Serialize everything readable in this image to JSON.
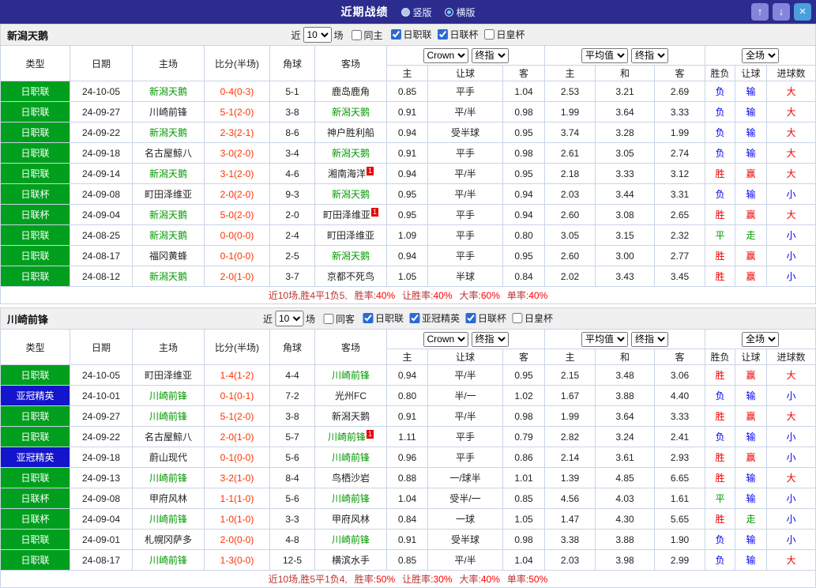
{
  "titlebar": {
    "title": "近期战绩",
    "vertical_label": "竖版",
    "horizontal_label": "横版",
    "selected_layout": "横版",
    "up_icon": "↑",
    "down_icon": "↓",
    "close_icon": "×"
  },
  "columns": {
    "type": "类型",
    "date": "日期",
    "home": "主场",
    "score": "比分(半场)",
    "corner": "角球",
    "away": "客场",
    "odds_source": "Crown",
    "odds_close": "终指",
    "avg_label": "平均值",
    "avg_close": "终指",
    "scope": "全场",
    "sub": [
      "主",
      "让球",
      "客",
      "主",
      "和",
      "客",
      "胜负",
      "让球",
      "进球数"
    ]
  },
  "colors": {
    "titlebar_bg": "#2c2c8e",
    "league_green": "#00a01e",
    "league_blue": "#1414cc",
    "focus_team_green": "#009900",
    "score_red": "#ff3300",
    "win_red": "#ee0000",
    "lose_blue": "#0000ee",
    "draw_green": "#009900"
  },
  "sections": [
    {
      "team": "新潟天鹅",
      "filter": {
        "near_label": "近",
        "count": "10",
        "games_label": "场",
        "same_label": "同主",
        "same_checked": false,
        "comps": [
          {
            "label": "日职联",
            "checked": true
          },
          {
            "label": "日联杯",
            "checked": true
          },
          {
            "label": "日皇杯",
            "checked": false
          }
        ]
      },
      "rows": [
        {
          "league": "日职联",
          "league_color": "green",
          "date": "24-10-05",
          "home": "新潟天鹅",
          "home_focus": true,
          "home_card": "",
          "score": "0-4(0-3)",
          "corner": "5-1",
          "away": "鹿岛鹿角",
          "away_focus": false,
          "away_card": "",
          "odds": [
            "0.85",
            "平手",
            "1.04"
          ],
          "avg": [
            "2.53",
            "3.21",
            "2.69"
          ],
          "results": [
            {
              "t": "负",
              "c": "blue"
            },
            {
              "t": "输",
              "c": "blue"
            },
            {
              "t": "大",
              "c": "red"
            }
          ]
        },
        {
          "league": "日职联",
          "league_color": "green",
          "date": "24-09-27",
          "home": "川崎前锋",
          "home_focus": false,
          "home_card": "",
          "score": "5-1(2-0)",
          "corner": "3-8",
          "away": "新潟天鹅",
          "away_focus": true,
          "away_card": "",
          "odds": [
            "0.91",
            "平/半",
            "0.98"
          ],
          "avg": [
            "1.99",
            "3.64",
            "3.33"
          ],
          "results": [
            {
              "t": "负",
              "c": "blue"
            },
            {
              "t": "输",
              "c": "blue"
            },
            {
              "t": "大",
              "c": "red"
            }
          ]
        },
        {
          "league": "日职联",
          "league_color": "green",
          "date": "24-09-22",
          "home": "新潟天鹅",
          "home_focus": true,
          "home_card": "",
          "score": "2-3(2-1)",
          "corner": "8-6",
          "away": "神户胜利船",
          "away_focus": false,
          "away_card": "",
          "odds": [
            "0.94",
            "受半球",
            "0.95"
          ],
          "avg": [
            "3.74",
            "3.28",
            "1.99"
          ],
          "results": [
            {
              "t": "负",
              "c": "blue"
            },
            {
              "t": "输",
              "c": "blue"
            },
            {
              "t": "大",
              "c": "red"
            }
          ]
        },
        {
          "league": "日职联",
          "league_color": "green",
          "date": "24-09-18",
          "home": "名古屋鲸八",
          "home_focus": false,
          "home_card": "",
          "score": "3-0(2-0)",
          "corner": "3-4",
          "away": "新潟天鹅",
          "away_focus": true,
          "away_card": "",
          "odds": [
            "0.91",
            "平手",
            "0.98"
          ],
          "avg": [
            "2.61",
            "3.05",
            "2.74"
          ],
          "results": [
            {
              "t": "负",
              "c": "blue"
            },
            {
              "t": "输",
              "c": "blue"
            },
            {
              "t": "大",
              "c": "red"
            }
          ]
        },
        {
          "league": "日职联",
          "league_color": "green",
          "date": "24-09-14",
          "home": "新潟天鹅",
          "home_focus": true,
          "home_card": "",
          "score": "3-1(2-0)",
          "corner": "4-6",
          "away": "湘南海洋",
          "away_focus": false,
          "away_card": "1",
          "odds": [
            "0.94",
            "平/半",
            "0.95"
          ],
          "avg": [
            "2.18",
            "3.33",
            "3.12"
          ],
          "results": [
            {
              "t": "胜",
              "c": "red"
            },
            {
              "t": "赢",
              "c": "red"
            },
            {
              "t": "大",
              "c": "red"
            }
          ]
        },
        {
          "league": "日联杯",
          "league_color": "green",
          "date": "24-09-08",
          "home": "町田泽维亚",
          "home_focus": false,
          "home_card": "",
          "score": "2-0(2-0)",
          "corner": "9-3",
          "away": "新潟天鹅",
          "away_focus": true,
          "away_card": "",
          "odds": [
            "0.95",
            "平/半",
            "0.94"
          ],
          "avg": [
            "2.03",
            "3.44",
            "3.31"
          ],
          "results": [
            {
              "t": "负",
              "c": "blue"
            },
            {
              "t": "输",
              "c": "blue"
            },
            {
              "t": "小",
              "c": "blue"
            }
          ]
        },
        {
          "league": "日联杯",
          "league_color": "green",
          "date": "24-09-04",
          "home": "新潟天鹅",
          "home_focus": true,
          "home_card": "",
          "score": "5-0(2-0)",
          "corner": "2-0",
          "away": "町田泽维亚",
          "away_focus": false,
          "away_card": "1",
          "odds": [
            "0.95",
            "平手",
            "0.94"
          ],
          "avg": [
            "2.60",
            "3.08",
            "2.65"
          ],
          "results": [
            {
              "t": "胜",
              "c": "red"
            },
            {
              "t": "赢",
              "c": "red"
            },
            {
              "t": "大",
              "c": "red"
            }
          ]
        },
        {
          "league": "日职联",
          "league_color": "green",
          "date": "24-08-25",
          "home": "新潟天鹅",
          "home_focus": true,
          "home_card": "",
          "score": "0-0(0-0)",
          "corner": "2-4",
          "away": "町田泽维亚",
          "away_focus": false,
          "away_card": "",
          "odds": [
            "1.09",
            "平手",
            "0.80"
          ],
          "avg": [
            "3.05",
            "3.15",
            "2.32"
          ],
          "results": [
            {
              "t": "平",
              "c": "green"
            },
            {
              "t": "走",
              "c": "green"
            },
            {
              "t": "小",
              "c": "blue"
            }
          ]
        },
        {
          "league": "日职联",
          "league_color": "green",
          "date": "24-08-17",
          "home": "福冈黄蜂",
          "home_focus": false,
          "home_card": "",
          "score": "0-1(0-0)",
          "corner": "2-5",
          "away": "新潟天鹅",
          "away_focus": true,
          "away_card": "",
          "odds": [
            "0.94",
            "平手",
            "0.95"
          ],
          "avg": [
            "2.60",
            "3.00",
            "2.77"
          ],
          "results": [
            {
              "t": "胜",
              "c": "red"
            },
            {
              "t": "赢",
              "c": "red"
            },
            {
              "t": "小",
              "c": "blue"
            }
          ]
        },
        {
          "league": "日职联",
          "league_color": "green",
          "date": "24-08-12",
          "home": "新潟天鹅",
          "home_focus": true,
          "home_card": "",
          "score": "2-0(1-0)",
          "corner": "3-7",
          "away": "京都不死鸟",
          "away_focus": false,
          "away_card": "",
          "odds": [
            "1.05",
            "半球",
            "0.84"
          ],
          "avg": [
            "2.02",
            "3.43",
            "3.45"
          ],
          "results": [
            {
              "t": "胜",
              "c": "red"
            },
            {
              "t": "赢",
              "c": "red"
            },
            {
              "t": "小",
              "c": "blue"
            }
          ]
        }
      ],
      "summary": {
        "prefix": "近10场,胜4平1负5,",
        "stats": [
          {
            "label": "胜率:",
            "value": "40%"
          },
          {
            "label": "让胜率:",
            "value": "40%"
          },
          {
            "label": "大率:",
            "value": "60%"
          },
          {
            "label": "单率:",
            "value": "40%"
          }
        ]
      }
    },
    {
      "team": "川崎前锋",
      "filter": {
        "near_label": "近",
        "count": "10",
        "games_label": "场",
        "same_label": "同客",
        "same_checked": false,
        "comps": [
          {
            "label": "日职联",
            "checked": true
          },
          {
            "label": "亚冠精英",
            "checked": true
          },
          {
            "label": "日联杯",
            "checked": true
          },
          {
            "label": "日皇杯",
            "checked": false
          }
        ]
      },
      "rows": [
        {
          "league": "日职联",
          "league_color": "green",
          "date": "24-10-05",
          "home": "町田泽维亚",
          "home_focus": false,
          "home_card": "",
          "score": "1-4(1-2)",
          "corner": "4-4",
          "away": "川崎前锋",
          "away_focus": true,
          "away_card": "",
          "odds": [
            "0.94",
            "平/半",
            "0.95"
          ],
          "avg": [
            "2.15",
            "3.48",
            "3.06"
          ],
          "results": [
            {
              "t": "胜",
              "c": "red"
            },
            {
              "t": "赢",
              "c": "red"
            },
            {
              "t": "大",
              "c": "red"
            }
          ]
        },
        {
          "league": "亚冠精英",
          "league_color": "blue",
          "date": "24-10-01",
          "home": "川崎前锋",
          "home_focus": true,
          "home_card": "",
          "score": "0-1(0-1)",
          "corner": "7-2",
          "away": "光州FC",
          "away_focus": false,
          "away_card": "",
          "odds": [
            "0.80",
            "半/一",
            "1.02"
          ],
          "avg": [
            "1.67",
            "3.88",
            "4.40"
          ],
          "results": [
            {
              "t": "负",
              "c": "blue"
            },
            {
              "t": "输",
              "c": "blue"
            },
            {
              "t": "小",
              "c": "blue"
            }
          ]
        },
        {
          "league": "日职联",
          "league_color": "green",
          "date": "24-09-27",
          "home": "川崎前锋",
          "home_focus": true,
          "home_card": "",
          "score": "5-1(2-0)",
          "corner": "3-8",
          "away": "新潟天鹅",
          "away_focus": false,
          "away_card": "",
          "odds": [
            "0.91",
            "平/半",
            "0.98"
          ],
          "avg": [
            "1.99",
            "3.64",
            "3.33"
          ],
          "results": [
            {
              "t": "胜",
              "c": "red"
            },
            {
              "t": "赢",
              "c": "red"
            },
            {
              "t": "大",
              "c": "red"
            }
          ]
        },
        {
          "league": "日职联",
          "league_color": "green",
          "date": "24-09-22",
          "home": "名古屋鲸八",
          "home_focus": false,
          "home_card": "",
          "score": "2-0(1-0)",
          "corner": "5-7",
          "away": "川崎前锋",
          "away_focus": true,
          "away_card": "1",
          "odds": [
            "1.11",
            "平手",
            "0.79"
          ],
          "avg": [
            "2.82",
            "3.24",
            "2.41"
          ],
          "results": [
            {
              "t": "负",
              "c": "blue"
            },
            {
              "t": "输",
              "c": "blue"
            },
            {
              "t": "小",
              "c": "blue"
            }
          ]
        },
        {
          "league": "亚冠精英",
          "league_color": "blue",
          "date": "24-09-18",
          "home": "蔚山现代",
          "home_focus": false,
          "home_card": "",
          "score": "0-1(0-0)",
          "corner": "5-6",
          "away": "川崎前锋",
          "away_focus": true,
          "away_card": "",
          "odds": [
            "0.96",
            "平手",
            "0.86"
          ],
          "avg": [
            "2.14",
            "3.61",
            "2.93"
          ],
          "results": [
            {
              "t": "胜",
              "c": "red"
            },
            {
              "t": "赢",
              "c": "red"
            },
            {
              "t": "小",
              "c": "blue"
            }
          ]
        },
        {
          "league": "日职联",
          "league_color": "green",
          "date": "24-09-13",
          "home": "川崎前锋",
          "home_focus": true,
          "home_card": "",
          "score": "3-2(1-0)",
          "corner": "8-4",
          "away": "鸟栖沙岩",
          "away_focus": false,
          "away_card": "",
          "odds": [
            "0.88",
            "一/球半",
            "1.01"
          ],
          "avg": [
            "1.39",
            "4.85",
            "6.65"
          ],
          "results": [
            {
              "t": "胜",
              "c": "red"
            },
            {
              "t": "输",
              "c": "blue"
            },
            {
              "t": "大",
              "c": "red"
            }
          ]
        },
        {
          "league": "日联杯",
          "league_color": "green",
          "date": "24-09-08",
          "home": "甲府风林",
          "home_focus": false,
          "home_card": "",
          "score": "1-1(1-0)",
          "corner": "5-6",
          "away": "川崎前锋",
          "away_focus": true,
          "away_card": "",
          "odds": [
            "1.04",
            "受半/一",
            "0.85"
          ],
          "avg": [
            "4.56",
            "4.03",
            "1.61"
          ],
          "results": [
            {
              "t": "平",
              "c": "green"
            },
            {
              "t": "输",
              "c": "blue"
            },
            {
              "t": "小",
              "c": "blue"
            }
          ]
        },
        {
          "league": "日联杯",
          "league_color": "green",
          "date": "24-09-04",
          "home": "川崎前锋",
          "home_focus": true,
          "home_card": "",
          "score": "1-0(1-0)",
          "corner": "3-3",
          "away": "甲府风林",
          "away_focus": false,
          "away_card": "",
          "odds": [
            "0.84",
            "一球",
            "1.05"
          ],
          "avg": [
            "1.47",
            "4.30",
            "5.65"
          ],
          "results": [
            {
              "t": "胜",
              "c": "red"
            },
            {
              "t": "走",
              "c": "green"
            },
            {
              "t": "小",
              "c": "blue"
            }
          ]
        },
        {
          "league": "日职联",
          "league_color": "green",
          "date": "24-09-01",
          "home": "札幌冈萨多",
          "home_focus": false,
          "home_card": "",
          "score": "2-0(0-0)",
          "corner": "4-8",
          "away": "川崎前锋",
          "away_focus": true,
          "away_card": "",
          "odds": [
            "0.91",
            "受半球",
            "0.98"
          ],
          "avg": [
            "3.38",
            "3.88",
            "1.90"
          ],
          "results": [
            {
              "t": "负",
              "c": "blue"
            },
            {
              "t": "输",
              "c": "blue"
            },
            {
              "t": "小",
              "c": "blue"
            }
          ]
        },
        {
          "league": "日职联",
          "league_color": "green",
          "date": "24-08-17",
          "home": "川崎前锋",
          "home_focus": true,
          "home_card": "",
          "score": "1-3(0-0)",
          "corner": "12-5",
          "away": "横滨水手",
          "away_focus": false,
          "away_card": "",
          "odds": [
            "0.85",
            "平/半",
            "1.04"
          ],
          "avg": [
            "2.03",
            "3.98",
            "2.99"
          ],
          "results": [
            {
              "t": "负",
              "c": "blue"
            },
            {
              "t": "输",
              "c": "blue"
            },
            {
              "t": "大",
              "c": "red"
            }
          ]
        }
      ],
      "summary": {
        "prefix": "近10场,胜5平1负4,",
        "stats": [
          {
            "label": "胜率:",
            "value": "50%"
          },
          {
            "label": "让胜率:",
            "value": "30%"
          },
          {
            "label": "大率:",
            "value": "40%"
          },
          {
            "label": "单率:",
            "value": "50%"
          }
        ]
      }
    }
  ]
}
